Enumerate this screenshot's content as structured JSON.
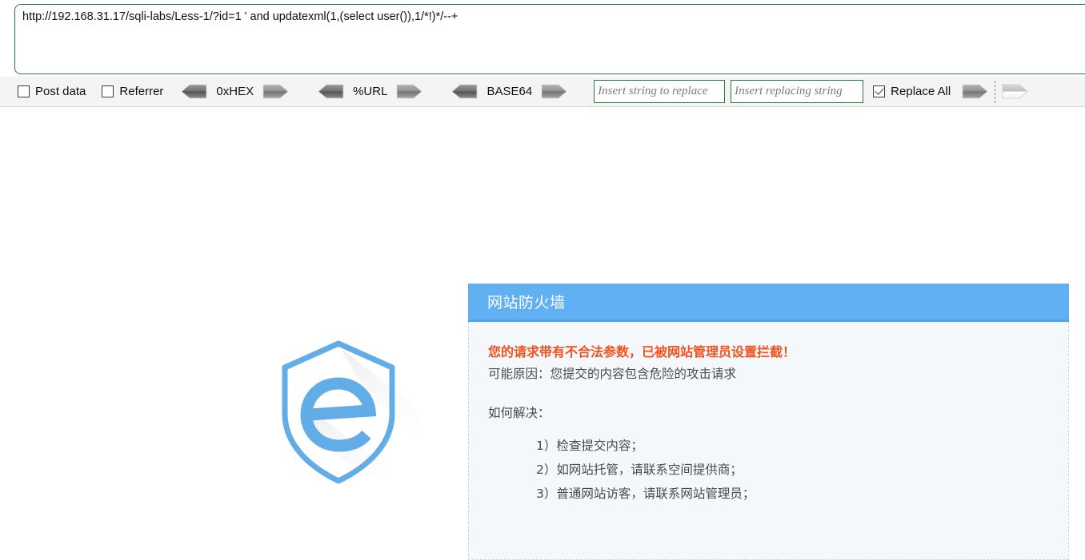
{
  "request": {
    "url_value": "http://192.168.31.17/sqli-labs/Less-1/?id=1 ' and updatexml(1,(select user()),1/*!)*/--+"
  },
  "toolbar": {
    "post_data_label": "Post data",
    "post_data_checked": false,
    "referrer_label": "Referrer",
    "referrer_checked": false,
    "codecs": [
      {
        "label": "0xHEX"
      },
      {
        "label": "%URL"
      },
      {
        "label": "BASE64"
      }
    ],
    "replace_from_placeholder": "Insert string to replace",
    "replace_from_value": "",
    "replace_to_placeholder": "Insert replacing string",
    "replace_to_value": "",
    "replace_all_label": "Replace All",
    "replace_all_checked": true
  },
  "logo": {
    "name": "shield-e-logo",
    "color": "#62ace8"
  },
  "firewall": {
    "title": "网站防火墙",
    "warning": "您的请求带有不合法参数，已被网站管理员设置拦截！",
    "reason": "可能原因：您提交的内容包含危险的攻击请求",
    "howto_label": "如何解决：",
    "steps": [
      "1）检查提交内容；",
      "2）如网站托管，请联系空间提供商；",
      "3）普通网站访客，请联系网站管理员；"
    ],
    "header_color": "#62b0f4",
    "warning_color": "#f4511e"
  }
}
